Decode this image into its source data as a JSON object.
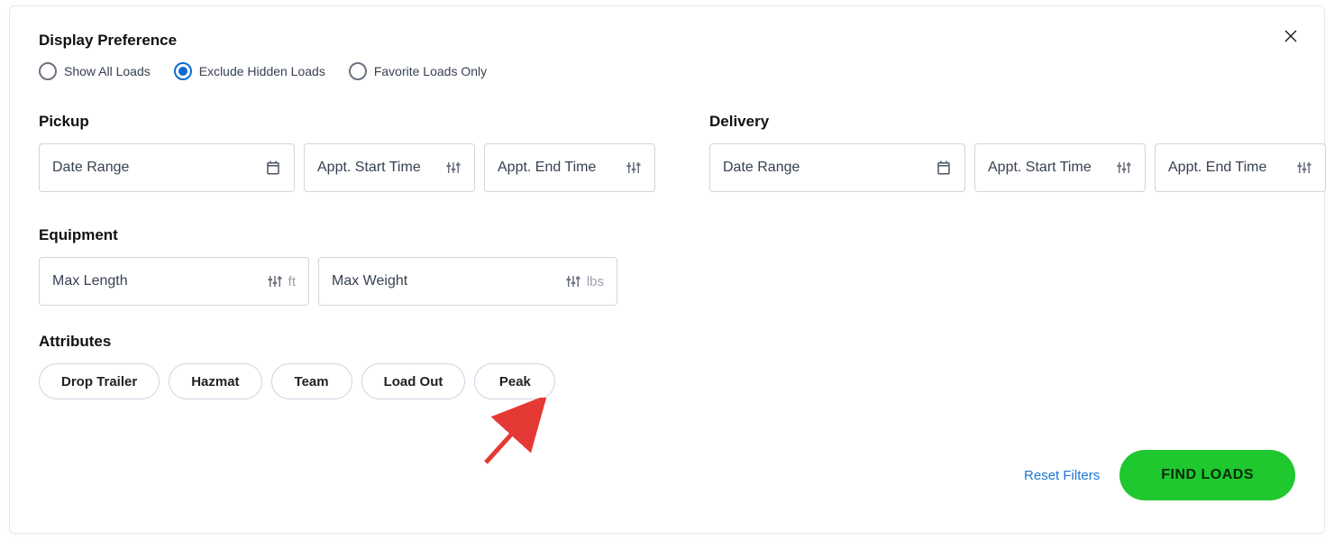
{
  "display_preference": {
    "title": "Display Preference",
    "options": {
      "show_all": "Show All Loads",
      "exclude_hidden": "Exclude Hidden Loads",
      "favorite_only": "Favorite Loads Only"
    },
    "selected": "exclude_hidden"
  },
  "pickup": {
    "title": "Pickup",
    "date_range_placeholder": "Date Range",
    "start_time_placeholder": "Appt. Start Time",
    "end_time_placeholder": "Appt. End Time"
  },
  "delivery": {
    "title": "Delivery",
    "date_range_placeholder": "Date Range",
    "start_time_placeholder": "Appt. Start Time",
    "end_time_placeholder": "Appt. End Time"
  },
  "equipment": {
    "title": "Equipment",
    "max_length_placeholder": "Max Length",
    "max_length_unit": "ft",
    "max_weight_placeholder": "Max Weight",
    "max_weight_unit": "lbs"
  },
  "attributes": {
    "title": "Attributes",
    "chips": {
      "drop_trailer": "Drop Trailer",
      "hazmat": "Hazmat",
      "team": "Team",
      "load_out": "Load Out",
      "peak": "Peak"
    }
  },
  "footer": {
    "reset": "Reset Filters",
    "find": "FIND LOADS"
  },
  "colors": {
    "primary_blue": "#0b6bd6",
    "link_blue": "#1976d2",
    "action_green": "#1ec82e",
    "border_gray": "#d1d5db"
  }
}
